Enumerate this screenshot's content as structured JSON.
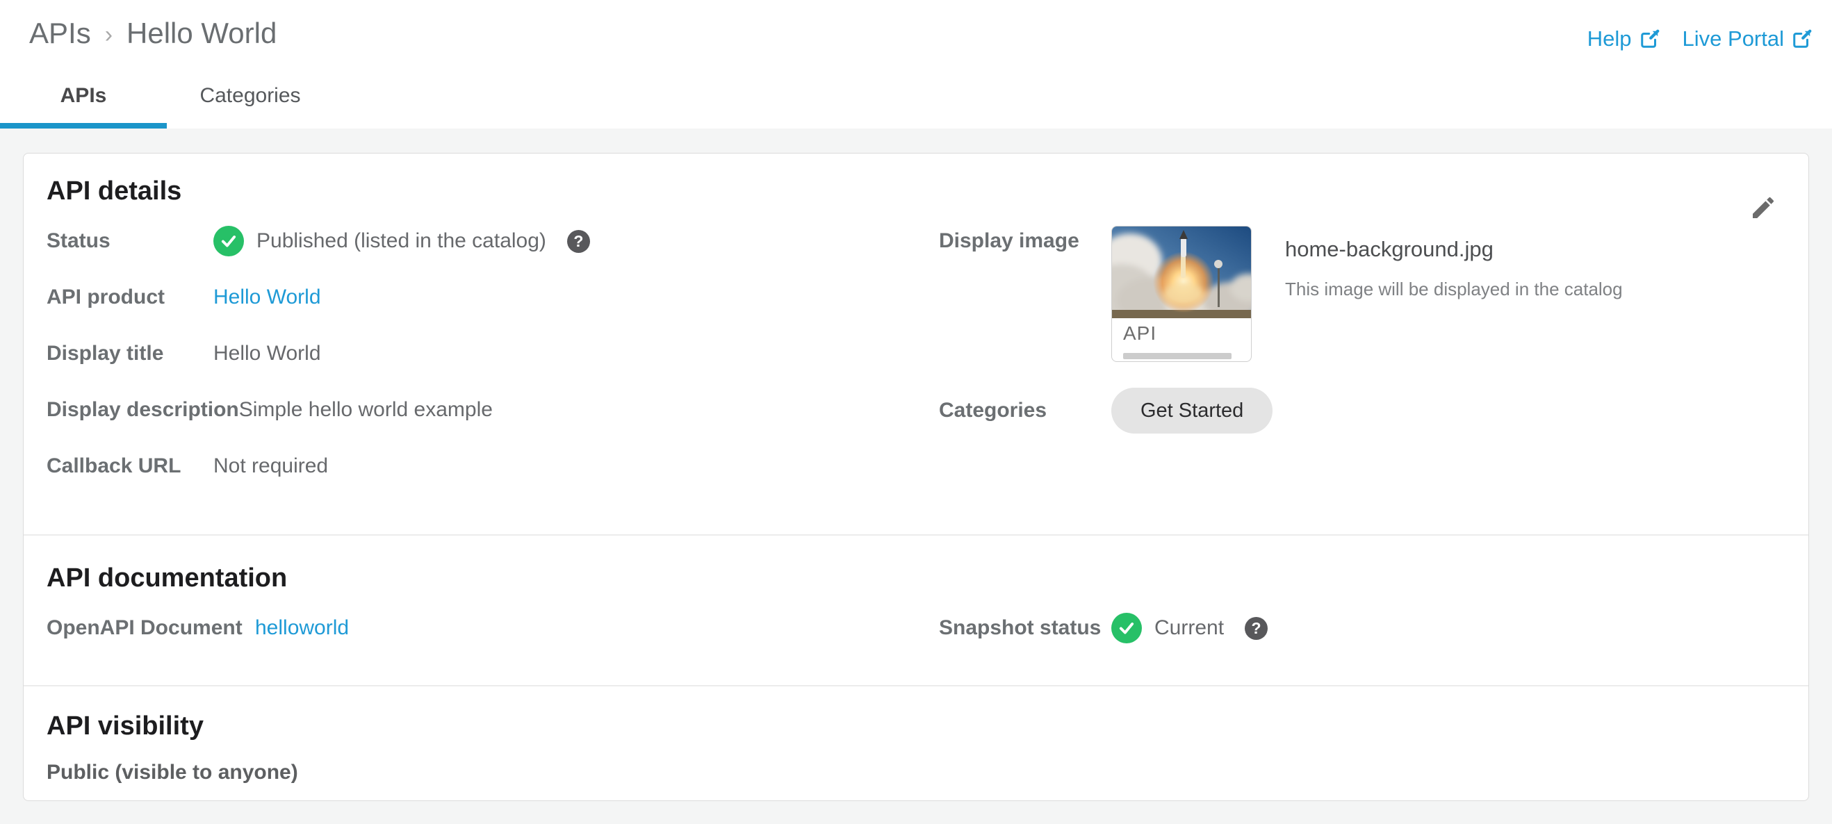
{
  "colors": {
    "accent_blue": "#1e9ad6",
    "tab_underline_blue": "#1b95c9",
    "success_green": "#27c067",
    "page_background": "#f4f5f5",
    "card_border": "#dcdcdc",
    "pill_background": "#e4e4e4",
    "help_badge_gray": "#58585b"
  },
  "breadcrumb": {
    "root": "APIs",
    "separator": "›",
    "current": "Hello World"
  },
  "header_links": {
    "help": {
      "label": "Help",
      "icon": "external-link-icon"
    },
    "live_portal": {
      "label": "Live Portal",
      "icon": "external-link-icon"
    }
  },
  "tabs": {
    "apis": {
      "label": "APIs",
      "active": true
    },
    "categories": {
      "label": "Categories",
      "active": false
    }
  },
  "api_details": {
    "title": "API details",
    "edit_icon": "pencil-icon",
    "status": {
      "label": "Status",
      "value": "Published (listed in the catalog)",
      "icon": "check-circle-icon",
      "help_icon": "question-mark-icon",
      "help_glyph": "?"
    },
    "product": {
      "label": "API product",
      "value": "Hello World"
    },
    "display_title": {
      "label": "Display title",
      "value": "Hello World"
    },
    "display_description": {
      "label": "Display description",
      "value": "Simple hello world example"
    },
    "callback_url": {
      "label": "Callback URL",
      "value": "Not required"
    },
    "display_image": {
      "label": "Display image",
      "thumb_title": "API",
      "thumb_image": "rocket-launch-photo",
      "filename": "home-background.jpg",
      "caption": "This image will be displayed in the catalog"
    },
    "categories": {
      "label": "Categories",
      "tag": "Get Started"
    }
  },
  "api_documentation": {
    "title": "API documentation",
    "openapi": {
      "label": "OpenAPI Document",
      "value": "helloworld"
    },
    "snapshot": {
      "label": "Snapshot status",
      "value": "Current",
      "icon": "check-circle-icon",
      "help_icon": "question-mark-icon",
      "help_glyph": "?"
    }
  },
  "api_visibility": {
    "title": "API visibility",
    "value": "Public (visible to anyone)"
  }
}
